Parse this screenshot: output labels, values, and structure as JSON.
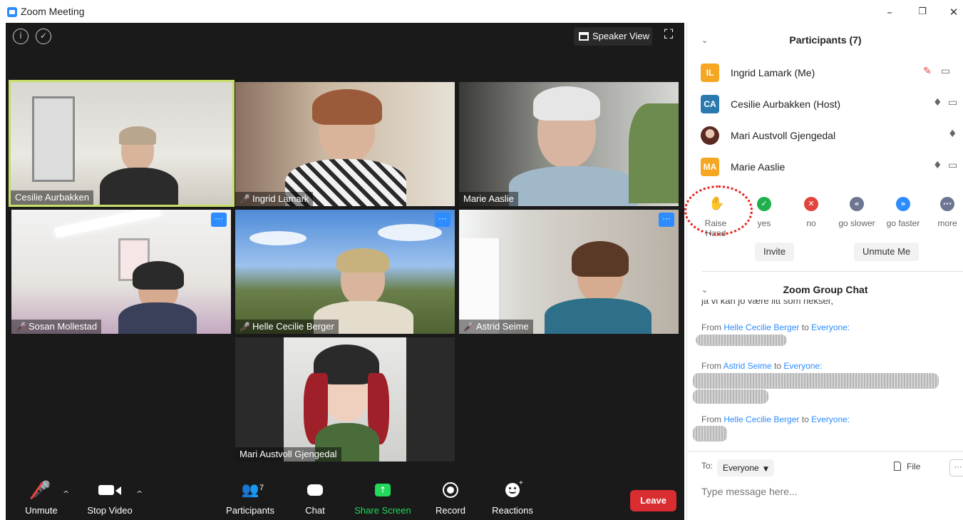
{
  "window": {
    "title": "Zoom Meeting",
    "minimize": "–",
    "maximize": "❐",
    "close": "✕"
  },
  "meeting": {
    "speaker_view_label": "Speaker View",
    "tiles": [
      {
        "name": "Cesilie Aurbakken",
        "muted": false,
        "active": true
      },
      {
        "name": "Ingrid Lamark",
        "muted": true
      },
      {
        "name": "Marie Aaslie",
        "muted": false
      },
      {
        "name": "Sosan Mollestad",
        "muted": true
      },
      {
        "name": "Helle Cecilie Berger",
        "muted": true
      },
      {
        "name": "Astrid Seime",
        "muted": true
      },
      {
        "name": "Mari Austvoll Gjengedal",
        "muted": false
      }
    ],
    "more_label": "···"
  },
  "toolbar": {
    "unmute": "Unmute",
    "stop_video": "Stop Video",
    "participants": "Participants",
    "participants_count": "7",
    "chat": "Chat",
    "share_screen": "Share Screen",
    "record": "Record",
    "reactions": "Reactions",
    "leave": "Leave"
  },
  "participants_panel": {
    "title": "Participants (7)",
    "list": [
      {
        "initials": "IL",
        "name": "Ingrid Lamark (Me)",
        "color": "#F5A623"
      },
      {
        "initials": "CA",
        "name": "Cesilie Aurbakken (Host)",
        "color": "#2A7AB0"
      },
      {
        "initials": "",
        "name": "Mari Austvoll Gjengedal",
        "color": "#7a4030"
      },
      {
        "initials": "MA",
        "name": "Marie Aaslie",
        "color": "#F5A623"
      }
    ],
    "reactions": [
      {
        "label": "Raise Hand"
      },
      {
        "label": "yes"
      },
      {
        "label": "no"
      },
      {
        "label": "go slower"
      },
      {
        "label": "go faster"
      },
      {
        "label": "more"
      }
    ],
    "invite": "Invite",
    "unmute_me": "Unmute Me"
  },
  "chat_panel": {
    "title": "Zoom Group Chat",
    "partial_line": "ja vi kan jo være litt som hekser,",
    "messages": [
      {
        "from_label": "From",
        "sender": "Helle Cecilie Berger",
        "to_label": "to",
        "recipient": "Everyone:"
      },
      {
        "from_label": "From",
        "sender": "Astrid Seime",
        "to_label": "to",
        "recipient": "Everyone:"
      },
      {
        "from_label": "From",
        "sender": "Helle Cecilie Berger",
        "to_label": "to",
        "recipient": "Everyone:"
      }
    ],
    "to_label": "To:",
    "to_value": "Everyone",
    "file_label": "File",
    "more_label": "···",
    "input_placeholder": "Type message here..."
  }
}
